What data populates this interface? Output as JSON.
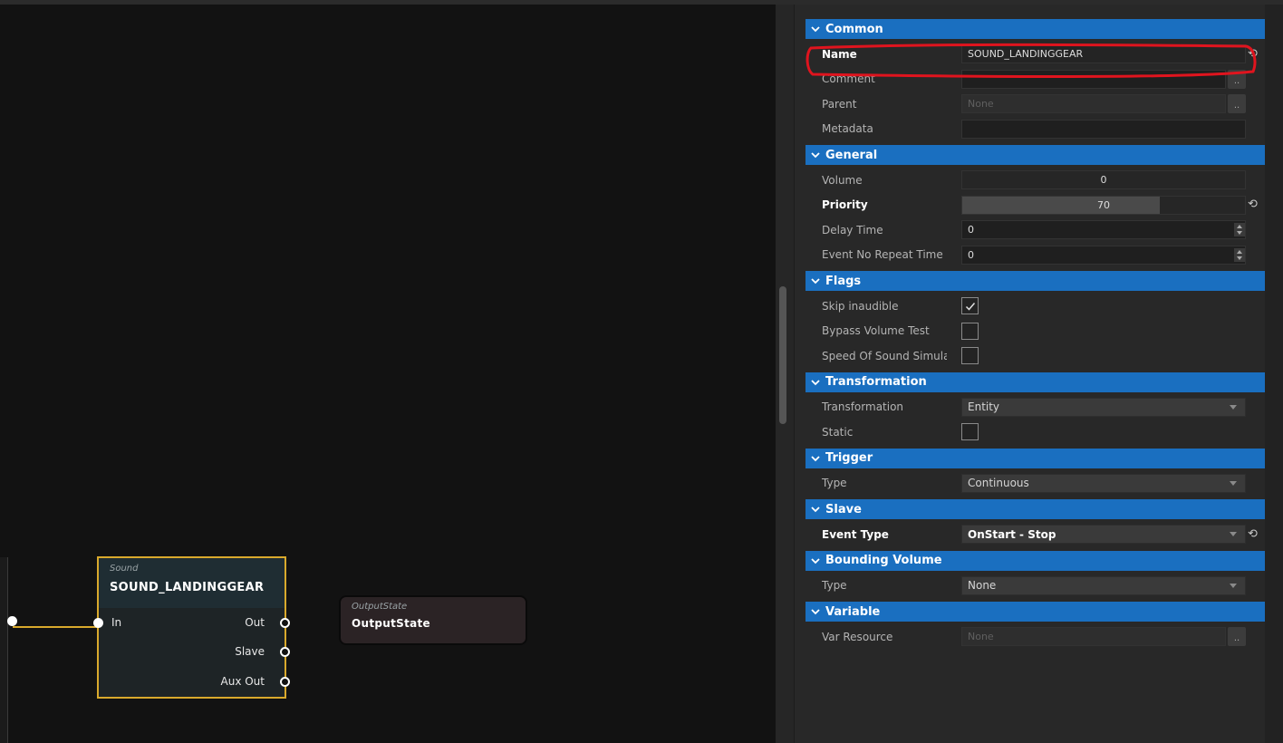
{
  "graph": {
    "sound_node": {
      "type": "Sound",
      "title": "SOUND_LANDINGGEAR",
      "pins": {
        "in": "In",
        "out": "Out",
        "slave": "Slave",
        "aux_out": "Aux Out"
      }
    },
    "output_node": {
      "type": "OutputState",
      "title": "OutputState"
    }
  },
  "sections": {
    "common": {
      "title": "Common",
      "name_label": "Name",
      "name_value": "SOUND_LANDINGGEAR",
      "comment_label": "Comment",
      "comment_value": "",
      "parent_label": "Parent",
      "parent_placeholder": "None",
      "metadata_label": "Metadata",
      "metadata_value": "",
      "dots": ".."
    },
    "general": {
      "title": "General",
      "volume_label": "Volume",
      "volume_value": "0",
      "volume_fraction": 0,
      "priority_label": "Priority",
      "priority_value": "70",
      "priority_fraction": 0.7,
      "delay_label": "Delay Time",
      "delay_value": "0",
      "norepeat_label": "Event No Repeat Time",
      "norepeat_value": "0"
    },
    "flags": {
      "title": "Flags",
      "skip_label": "Skip inaudible",
      "skip_checked": true,
      "bypass_label": "Bypass Volume Test",
      "bypass_checked": false,
      "speed_label": "Speed Of Sound Simulat",
      "speed_checked": false
    },
    "transformation": {
      "title": "Transformation",
      "transform_label": "Transformation",
      "transform_value": "Entity",
      "static_label": "Static",
      "static_checked": false
    },
    "trigger": {
      "title": "Trigger",
      "type_label": "Type",
      "type_value": "Continuous"
    },
    "slave": {
      "title": "Slave",
      "event_type_label": "Event Type",
      "event_type_value": "OnStart - Stop"
    },
    "bounding_volume": {
      "title": "Bounding Volume",
      "type_label": "Type",
      "type_value": "None"
    },
    "variable": {
      "title": "Variable",
      "var_resource_label": "Var Resource",
      "var_resource_placeholder": "None",
      "dots": ".."
    }
  },
  "colors": {
    "section_header": "#1a6fc0",
    "node_selected_border": "#d9a92c",
    "annotation": "#e0141e"
  },
  "icons": {
    "section_chevron": "chevron-down-icon",
    "reset": "reset-arrow-icon",
    "check": "check-icon"
  }
}
